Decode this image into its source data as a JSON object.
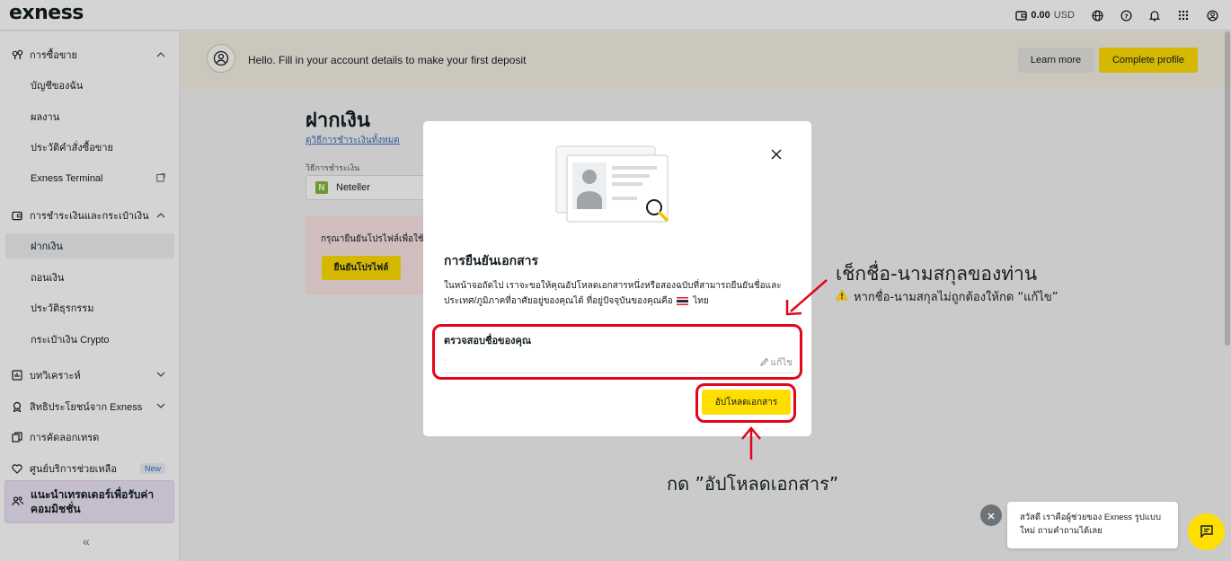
{
  "app": {
    "logo": "exness"
  },
  "topbar": {
    "balance_amount": "0.00",
    "balance_currency": "USD",
    "icons": [
      "wallet-icon",
      "globe-icon",
      "help-icon",
      "bell-icon",
      "grid-icon",
      "user-icon"
    ]
  },
  "sidebar": {
    "items": [
      {
        "label": "การซื้อขาย",
        "icon": "trading-icon",
        "type": "section",
        "expanded": true
      },
      {
        "label": "บัญชีของฉัน",
        "type": "sub"
      },
      {
        "label": "ผลงาน",
        "type": "sub"
      },
      {
        "label": "ประวัติคำสั่งซื้อขาย",
        "type": "sub"
      },
      {
        "label": "Exness Terminal",
        "type": "sub",
        "external": true
      },
      {
        "label": "การชำระเงินและกระเป๋าเงิน",
        "icon": "wallet-icon",
        "type": "section",
        "expanded": true
      },
      {
        "label": "ฝากเงิน",
        "type": "sub",
        "active": true
      },
      {
        "label": "ถอนเงิน",
        "type": "sub"
      },
      {
        "label": "ประวัติธุรกรรม",
        "type": "sub"
      },
      {
        "label": "กระเป๋าเงิน Crypto",
        "type": "sub"
      },
      {
        "label": "บทวิเคราะห์",
        "icon": "analytics-icon",
        "type": "section",
        "expanded": false
      },
      {
        "label": "สิทธิประโยชน์จาก Exness",
        "icon": "benefits-icon",
        "type": "section",
        "expanded": false
      },
      {
        "label": "การคัดลอกเทรด",
        "icon": "copy-trade-icon",
        "type": "section"
      },
      {
        "label": "ศูนย์บริการช่วยเหลือ",
        "icon": "heart-icon",
        "type": "section",
        "badge": "New"
      }
    ],
    "promo": "แนะนำเทรดเดอร์เพื่อรับค่าคอมมิชชั่น",
    "collapse": "«"
  },
  "banner": {
    "message": "Hello. Fill in your account details to make your first deposit",
    "learn_more": "Learn more",
    "complete_profile": "Complete profile"
  },
  "deposit": {
    "title": "ฝากเงิน",
    "link": "ดูวิธีการชำระเงินทั้งหมด",
    "method_label": "วิธีการชำระเงิน",
    "method_logo": "N",
    "method": "Neteller",
    "verify_text": "กรุณายืนยันโปรไฟล์เพื่อใช้",
    "verify_button": "ยืนยันโปรไฟล์"
  },
  "modal": {
    "title": "การยืนยันเอกสาร",
    "desc_line1": "ในหน้าจอถัดไป เราจะขอให้คุณอัปโหลดเอกสารหนึ่งหรือสองฉบับที่สามารถยืนยันชื่อและ",
    "desc_line2": "ประเทศ/ภูมิภาคที่อาศัยอยู่ของคุณได้ ที่อยู่ปัจจุบันของคุณคือ",
    "country": "ไทย",
    "name_section_title": "ตรวจสอบชื่อของคุณ",
    "name_value": ":",
    "edit_label": "แก้ไข",
    "upload_button": "อัปโหลดเอกสาร"
  },
  "annotations": {
    "title": "เช็กชื่อ-นามสกุลของท่าน",
    "subtitle": "หากชื่อ-นามสกุลไม่ถูกต้องให้กด “แก้ไข”",
    "bottom": "กด ”อัปโหลดเอกสาร”",
    "color": "#e1061b"
  },
  "chat": {
    "message": "สวัสดี เราคือผู้ช่วยของ Exness รูปแบบใหม่ ถามคำถามได้เลย"
  },
  "colors": {
    "accent_yellow": "#ffde02",
    "banner_bg": "#f6f0e4",
    "promo_bg": "#ece5f6",
    "link_blue": "#3d71b7",
    "alert_bg": "#fbe4e4"
  }
}
